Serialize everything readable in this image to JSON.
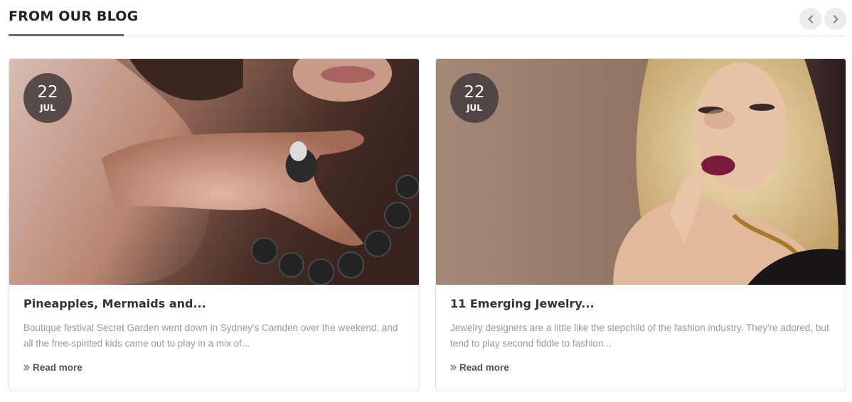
{
  "section": {
    "title": "FROM OUR BLOG",
    "nav": {
      "prev_icon": "chevron-left-icon",
      "next_icon": "chevron-right-icon"
    }
  },
  "posts": [
    {
      "date": {
        "day": "22",
        "month": "JUL"
      },
      "title": "Pineapples, Mermaids and...",
      "excerpt": "Boutique festival Secret Garden went down in Sydney's Camden over the weekend, and all the free-spirited kids came out to play in a mix of...",
      "read_more": "Read more",
      "image_alt": "Woman wearing a ring and dark necklace"
    },
    {
      "date": {
        "day": "22",
        "month": "JUL"
      },
      "title": "11 Emerging Jewelry...",
      "excerpt": "Jewelry designers are a little like the stepchild of the fashion industry. They're adored, but tend to play second fiddle to fashion...",
      "read_more": "Read more",
      "image_alt": "Blonde woman wearing gold earrings and necklace"
    }
  ],
  "colors": {
    "accent_underline": "#6b6b6b",
    "badge_bg": "#463e3c",
    "excerpt_text": "#9a9a9a"
  }
}
